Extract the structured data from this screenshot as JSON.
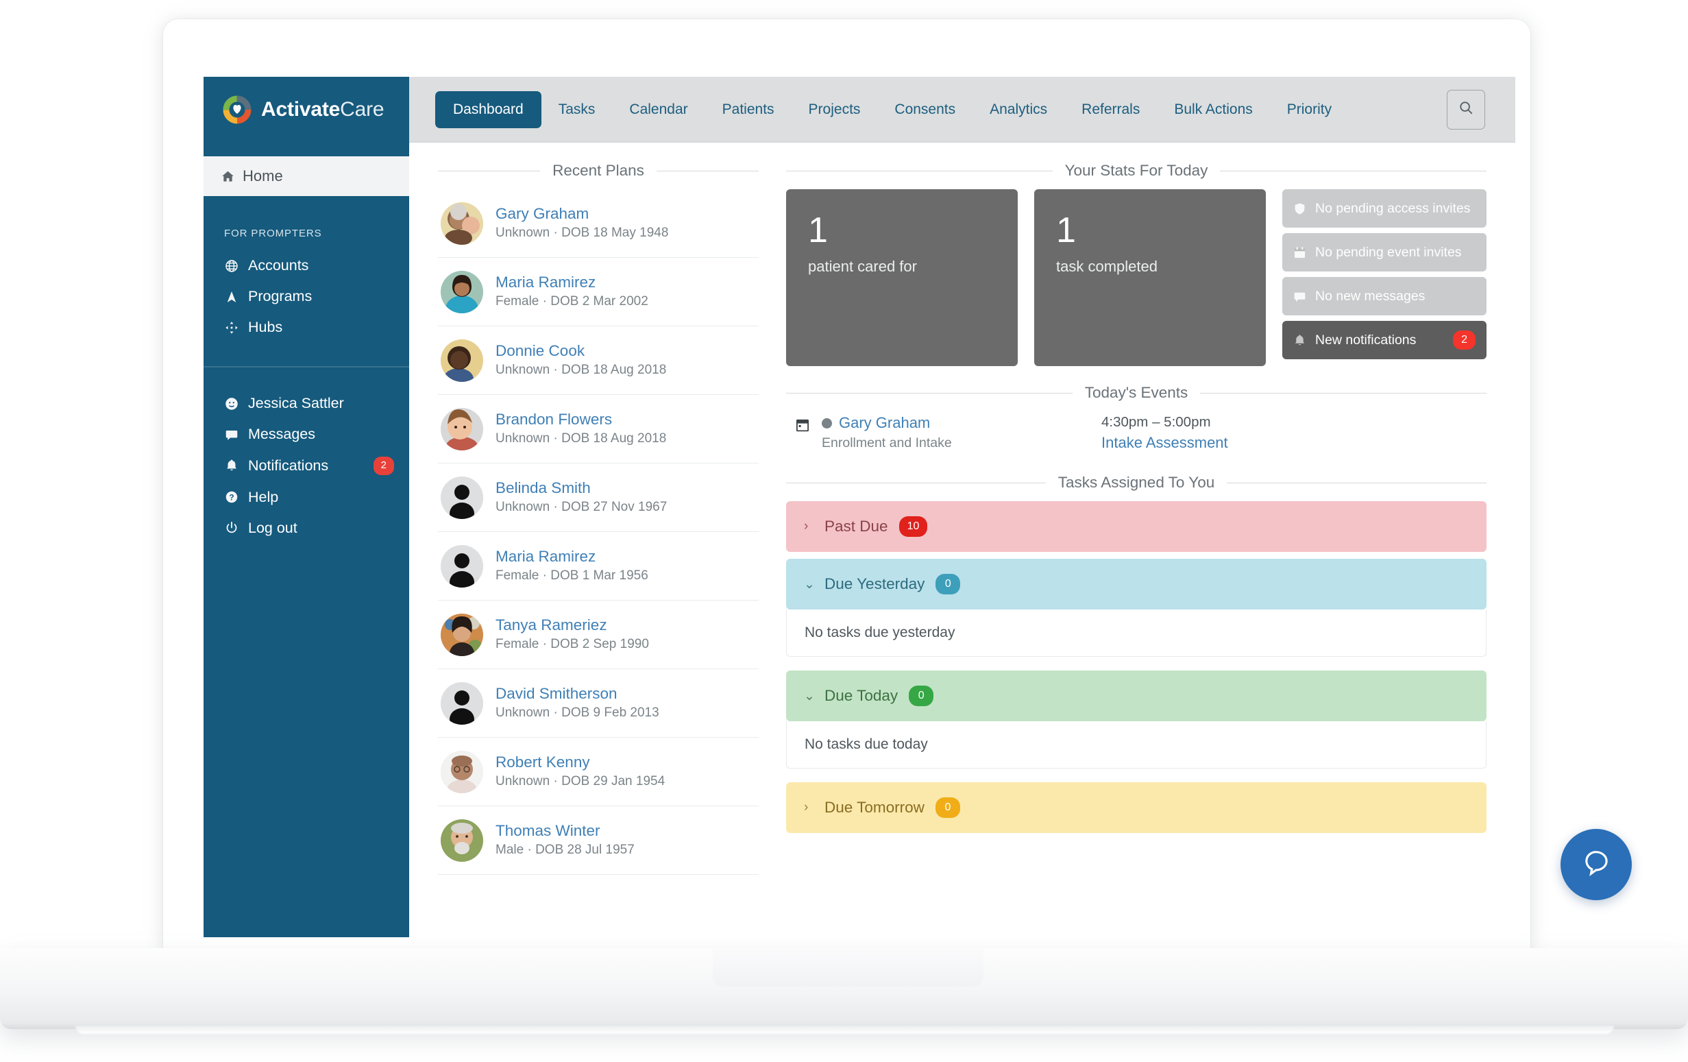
{
  "brand": {
    "name_bold": "Activate",
    "name_light": "Care",
    "logo_icon": "activate-care-ring-logo"
  },
  "sidebar": {
    "home": {
      "label": "Home",
      "icon": "home-icon"
    },
    "group_label": "FOR PROMPTERS",
    "group_items": [
      {
        "label": "Accounts",
        "icon": "globe-icon"
      },
      {
        "label": "Programs",
        "icon": "navigation-arrow-icon"
      },
      {
        "label": "Hubs",
        "icon": "hub-expand-icon"
      }
    ],
    "user_items": [
      {
        "label": "Jessica Sattler",
        "icon": "user-face-icon",
        "badge": ""
      },
      {
        "label": "Messages",
        "icon": "message-icon",
        "badge": ""
      },
      {
        "label": "Notifications",
        "icon": "bell-icon",
        "badge": "2"
      },
      {
        "label": "Help",
        "icon": "question-circle-icon",
        "badge": ""
      },
      {
        "label": "Log out",
        "icon": "power-icon",
        "badge": ""
      }
    ]
  },
  "topbar": {
    "tabs": [
      {
        "label": "Dashboard",
        "active": true
      },
      {
        "label": "Tasks",
        "active": false
      },
      {
        "label": "Calendar",
        "active": false
      },
      {
        "label": "Patients",
        "active": false
      },
      {
        "label": "Projects",
        "active": false
      },
      {
        "label": "Consents",
        "active": false
      },
      {
        "label": "Analytics",
        "active": false
      },
      {
        "label": "Referrals",
        "active": false
      },
      {
        "label": "Bulk Actions",
        "active": false
      },
      {
        "label": "Priority",
        "active": false
      }
    ],
    "search_icon": "search-icon"
  },
  "recent_plans": {
    "title": "Recent Plans",
    "items": [
      {
        "name": "Gary Graham",
        "meta": "Unknown · DOB 18 May 1948",
        "avatar": "photo-elder-man"
      },
      {
        "name": "Maria Ramirez",
        "meta": "Female · DOB 2 Mar 2002",
        "avatar": "photo-young-woman"
      },
      {
        "name": "Donnie Cook",
        "meta": "Unknown · DOB 18 Aug 2018",
        "avatar": "photo-toddler-boy"
      },
      {
        "name": "Brandon Flowers",
        "meta": "Unknown · DOB 18 Aug 2018",
        "avatar": "photo-toddler"
      },
      {
        "name": "Belinda Smith",
        "meta": "Unknown · DOB 27 Nov 1967",
        "avatar": "placeholder-silhouette"
      },
      {
        "name": "Maria Ramirez",
        "meta": "Female · DOB 1 Mar 1956",
        "avatar": "placeholder-silhouette"
      },
      {
        "name": "Tanya Rameriez",
        "meta": "Female · DOB 2 Sep 1990",
        "avatar": "photo-woman-dark-hair"
      },
      {
        "name": "David Smitherson",
        "meta": "Unknown · DOB 9 Feb 2013",
        "avatar": "placeholder-silhouette"
      },
      {
        "name": "Robert Kenny",
        "meta": "Unknown · DOB 29 Jan 1954",
        "avatar": "photo-bald-man-glasses"
      },
      {
        "name": "Thomas Winter",
        "meta": "Male · DOB 28 Jul 1957",
        "avatar": "photo-senior-man-beard"
      }
    ]
  },
  "stats": {
    "title": "Your Stats For Today",
    "cards": [
      {
        "number": "1",
        "label": "patient cared for"
      },
      {
        "number": "1",
        "label": "task completed"
      }
    ],
    "pills": [
      {
        "label": "No pending access invites",
        "icon": "shield-icon",
        "count": "",
        "state": "muted"
      },
      {
        "label": "No pending event invites",
        "icon": "calendar-icon",
        "count": "",
        "state": "muted"
      },
      {
        "label": "No new messages",
        "icon": "message-icon",
        "count": "",
        "state": "muted"
      },
      {
        "label": "New notifications",
        "icon": "bell-icon",
        "count": "2",
        "state": "active"
      }
    ]
  },
  "events": {
    "title": "Today's Events",
    "items": [
      {
        "icon": "calendar-icon",
        "patient": "Gary Graham",
        "program": "Enrollment and Intake",
        "time": "4:30pm – 5:00pm",
        "link": "Intake Assessment"
      }
    ]
  },
  "tasks": {
    "title": "Tasks Assigned To You",
    "groups": [
      {
        "label": "Past Due",
        "count": "10",
        "expanded": false,
        "empty_text": ""
      },
      {
        "label": "Due Yesterday",
        "count": "0",
        "expanded": true,
        "empty_text": "No tasks due yesterday"
      },
      {
        "label": "Due Today",
        "count": "0",
        "expanded": true,
        "empty_text": "No tasks due today"
      },
      {
        "label": "Due Tomorrow",
        "count": "0",
        "expanded": false,
        "empty_text": ""
      }
    ],
    "chevron_collapsed": "›",
    "chevron_expanded": "⌄"
  },
  "chat": {
    "icon": "chat-bubble-icon"
  },
  "colors": {
    "sidebar": "#165a7d",
    "topbar": "#dcdedf",
    "link": "#3f7fb5",
    "stat_card": "#6b6b6b",
    "badge_red": "#e8413a",
    "past_due": "#f4c3c8",
    "due_yesterday": "#bbe1ea",
    "due_today": "#c3e3c6",
    "due_tomorrow": "#fbe9ac",
    "chat": "#2a6fb8"
  }
}
